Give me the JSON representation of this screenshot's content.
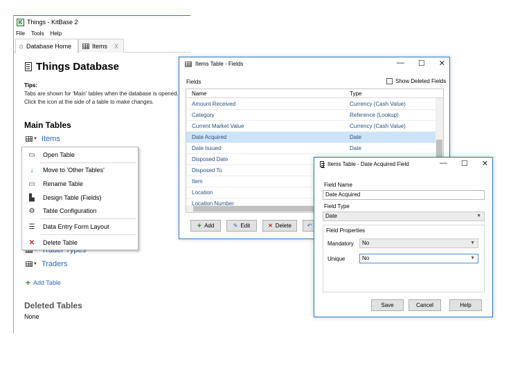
{
  "main": {
    "title": "Things - KitBase 2",
    "menu": [
      "File",
      "Tools",
      "Help"
    ],
    "tabs": [
      {
        "label": "Database Home",
        "icon": "home-icon"
      },
      {
        "label": "Items",
        "icon": "table-icon",
        "close": "X"
      }
    ],
    "page_title": "Things Database",
    "tips_label": "Tips:",
    "tips_lines": [
      "Tabs are shown for 'Main' tables when the database is opened.",
      "Click the icon at the side of a table to make changes."
    ],
    "main_tables_heading": "Main Tables",
    "tables": [
      "Items",
      "Trader Types",
      "Traders"
    ],
    "add_table": "Add Table",
    "deleted_heading": "Deleted Tables",
    "deleted_none": "None"
  },
  "context_menu": [
    {
      "label": "Open Table",
      "icon": "open-table-icon"
    },
    {
      "label": "Move to 'Other Tables'",
      "icon": "arrow-down-icon"
    },
    {
      "label": "Rename Table",
      "icon": "rename-icon"
    },
    {
      "label": "Design Table (Fields)",
      "icon": "design-icon"
    },
    {
      "label": "Table Configuration",
      "icon": "gear-icon"
    },
    {
      "label": "Data Entry Form Layout",
      "icon": "form-icon"
    },
    {
      "label": "Delete Table",
      "icon": "delete-x-icon"
    }
  ],
  "fields_dialog": {
    "title": "Items Table - Fields",
    "fields_label": "Fields",
    "show_deleted": "Show Deleted Fields",
    "columns": [
      "Name",
      "Type"
    ],
    "rows": [
      {
        "name": "Amount Received",
        "type": "Currency (Cash Value)"
      },
      {
        "name": "Category",
        "type": "Reference (Lookup)"
      },
      {
        "name": "Current Market Value",
        "type": "Currency (Cash Value)"
      },
      {
        "name": "Date Acquired",
        "type": "Date"
      },
      {
        "name": "Date Issued",
        "type": "Date"
      },
      {
        "name": "Disposed Date",
        "type": "Date"
      },
      {
        "name": "Disposed To",
        "type": ""
      },
      {
        "name": "Item",
        "type": ""
      },
      {
        "name": "Location",
        "type": ""
      },
      {
        "name": "Location Number",
        "type": ""
      }
    ],
    "selected_row": "Date Acquired",
    "buttons": {
      "add": "Add",
      "edit": "Edit",
      "delete": "Delete"
    }
  },
  "field_dialog": {
    "title": "Items Table - Date Acquired Field",
    "field_name_label": "Field Name",
    "field_name_value": "Date Acquired",
    "field_type_label": "Field Type",
    "field_type_value": "Date",
    "properties_label": "Field Properties",
    "mandatory_label": "Mandatory",
    "mandatory_value": "No",
    "unique_label": "Unique",
    "unique_value": "No",
    "buttons": {
      "save": "Save",
      "cancel": "Cancel",
      "help": "Help"
    }
  },
  "colors": {
    "accent": "#2b78d0",
    "link": "#2b66b5",
    "selection": "#cde3f7",
    "add_green": "#2e8b2e",
    "delete_red": "#cc2222"
  }
}
